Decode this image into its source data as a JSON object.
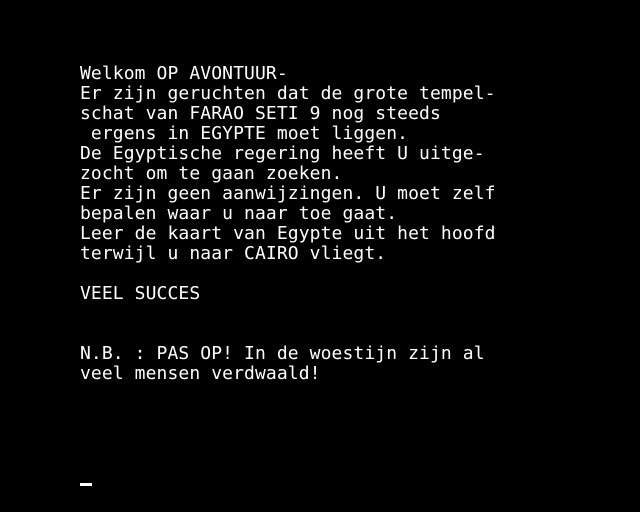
{
  "screen": {
    "intro_lines": [
      "Welkom OP AVONTUUR-",
      "Er zijn geruchten dat de grote tempel-",
      "schat van FARAO SETI 9 nog steeds",
      " ergens in EGYPTE moet liggen.",
      "De Egyptische regering heeft U uitge-",
      "zocht om te gaan zoeken.",
      "Er zijn geen aanwijzingen. U moet zelf",
      "bepalen waar u naar toe gaat.",
      "Leer de kaart van Egypte uit het hoofd",
      "terwijl u naar CAIRO vliegt."
    ],
    "good_luck": "VEEL SUCCES",
    "warning_lines": [
      "N.B. : PAS OP! In de woestijn zijn al",
      "veel mensen verdwaald!"
    ]
  },
  "colors": {
    "background": "#000000",
    "text": "#ffffff"
  }
}
